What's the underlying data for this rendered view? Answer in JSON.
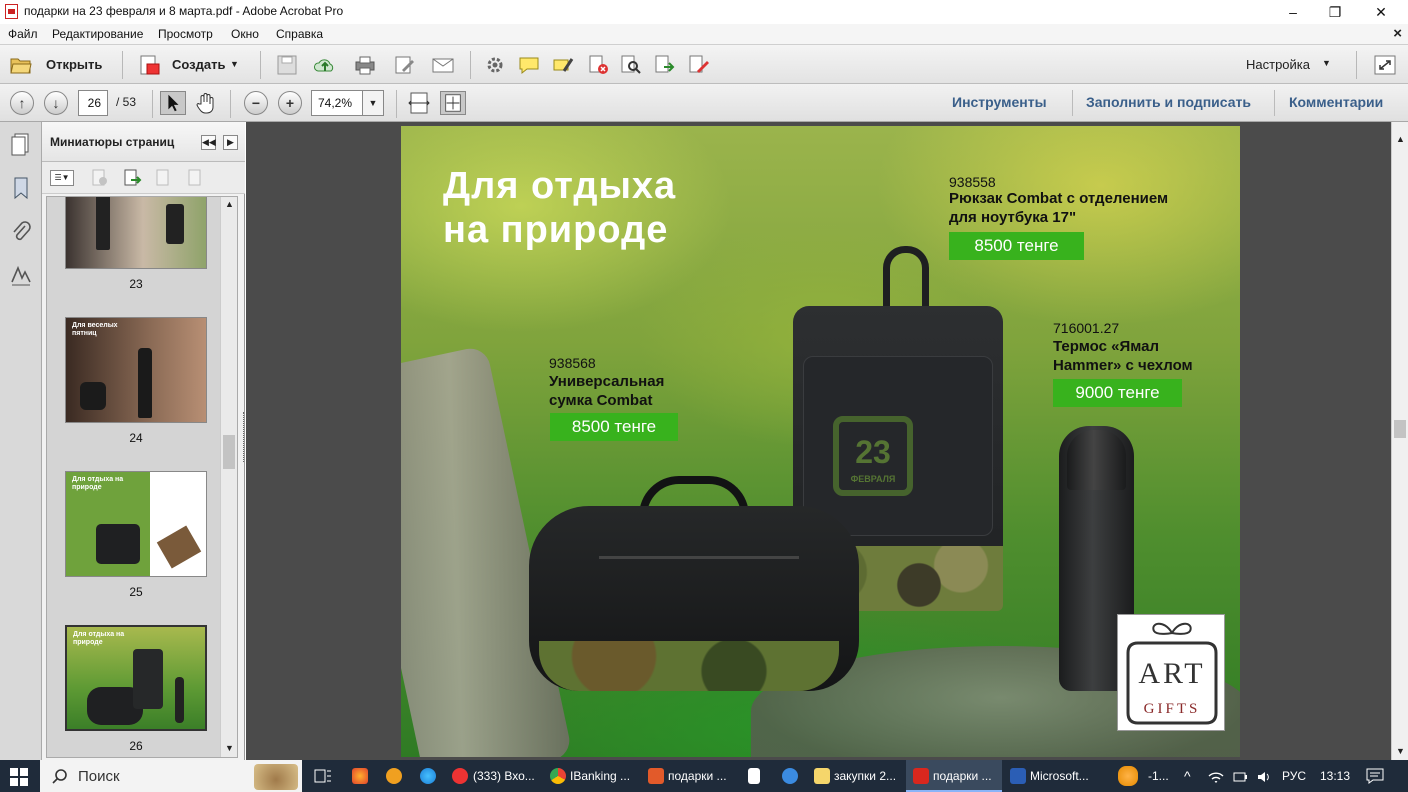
{
  "window": {
    "title": "подарки на 23 февраля и 8 марта.pdf - Adobe Acrobat Pro",
    "minimize": "–",
    "restore": "❐",
    "close": "✕"
  },
  "menu": {
    "items": [
      "Файл",
      "Редактирование",
      "Просмотр",
      "Окно",
      "Справка"
    ],
    "close": "×"
  },
  "toolbar": {
    "open_label": "Открыть",
    "create_label": "Создать",
    "settings_label": "Настройка"
  },
  "nav": {
    "page_current": "26",
    "page_total": "/ 53",
    "zoom": "74,2%",
    "tabs": [
      "Инструменты",
      "Заполнить и подписать",
      "Комментарии"
    ]
  },
  "panel": {
    "title": "Миниатюры страниц",
    "thumbnails": [
      {
        "num": "23"
      },
      {
        "num": "24",
        "caption": "Для веселых пятниц"
      },
      {
        "num": "25",
        "caption": "Для отдыха на природе"
      },
      {
        "num": "26",
        "caption": "Для отдыха на природе"
      }
    ]
  },
  "page": {
    "title_line1": "Для отдыха",
    "title_line2": "на природе",
    "products": [
      {
        "sku": "938558",
        "name_line1": "Рюкзак Combat с отделением",
        "name_line2": "для ноутбука 17\"",
        "price": "8500 тенге"
      },
      {
        "sku": "716001.27",
        "name_line1": "Термос «Ямал",
        "name_line2": "Hammer» с чехлом",
        "price": "9000 тенге"
      },
      {
        "sku": "938568",
        "name_line1": "Универсальная",
        "name_line2": "сумка Combat",
        "price": "8500 тенге"
      }
    ],
    "backpack_logo": "23",
    "backpack_logo_sub": "ФЕВРАЛЯ",
    "logo_top": "ART",
    "logo_bottom": "GIFTS"
  },
  "taskbar": {
    "search_label": "Поиск",
    "items": [
      "(333) Вхо...",
      "IBanking ...",
      "подарки ...",
      "закупки 2...",
      "подарки ...",
      "Microsoft...",
      "-1..."
    ],
    "lang": "РУС",
    "time": "13:13"
  },
  "colors": {
    "price_green": "#38b21d",
    "taskbar": "#1f2b3a",
    "tab_link": "#3a5f8a"
  }
}
